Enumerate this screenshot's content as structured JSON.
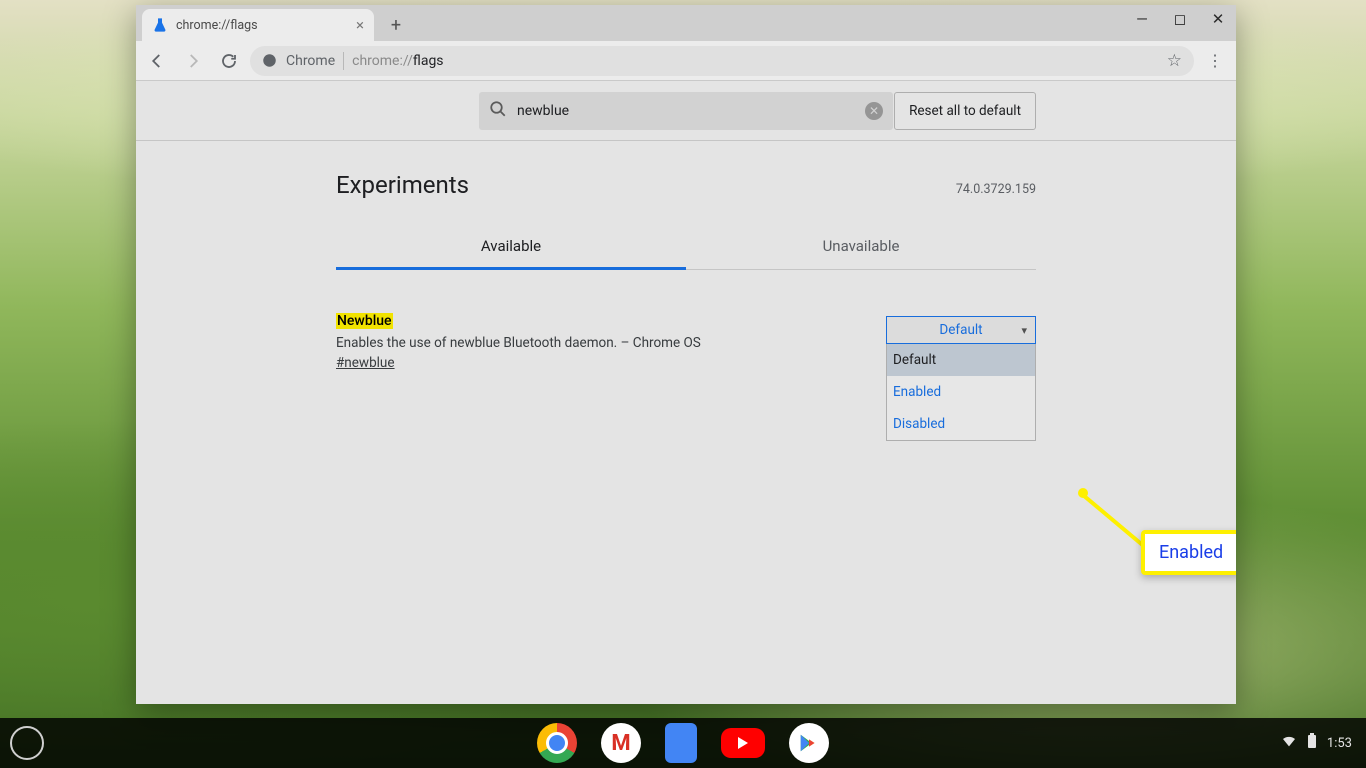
{
  "tab": {
    "title": "chrome://flags"
  },
  "toolbar": {
    "chrome_label": "Chrome",
    "url_prefix": "chrome://",
    "url_path": "flags"
  },
  "search": {
    "value": "newblue"
  },
  "reset_label": "Reset all to default",
  "page_title": "Experiments",
  "version": "74.0.3729.159",
  "tabs": {
    "available": "Available",
    "unavailable": "Unavailable"
  },
  "flag": {
    "name": "Newblue",
    "desc": "Enables the use of newblue Bluetooth daemon. – Chrome OS",
    "hash": "#newblue"
  },
  "dropdown": {
    "selected": "Default",
    "options": [
      "Default",
      "Enabled",
      "Disabled"
    ]
  },
  "annotation": {
    "label": "Enabled"
  },
  "tray": {
    "time": "1:53"
  }
}
